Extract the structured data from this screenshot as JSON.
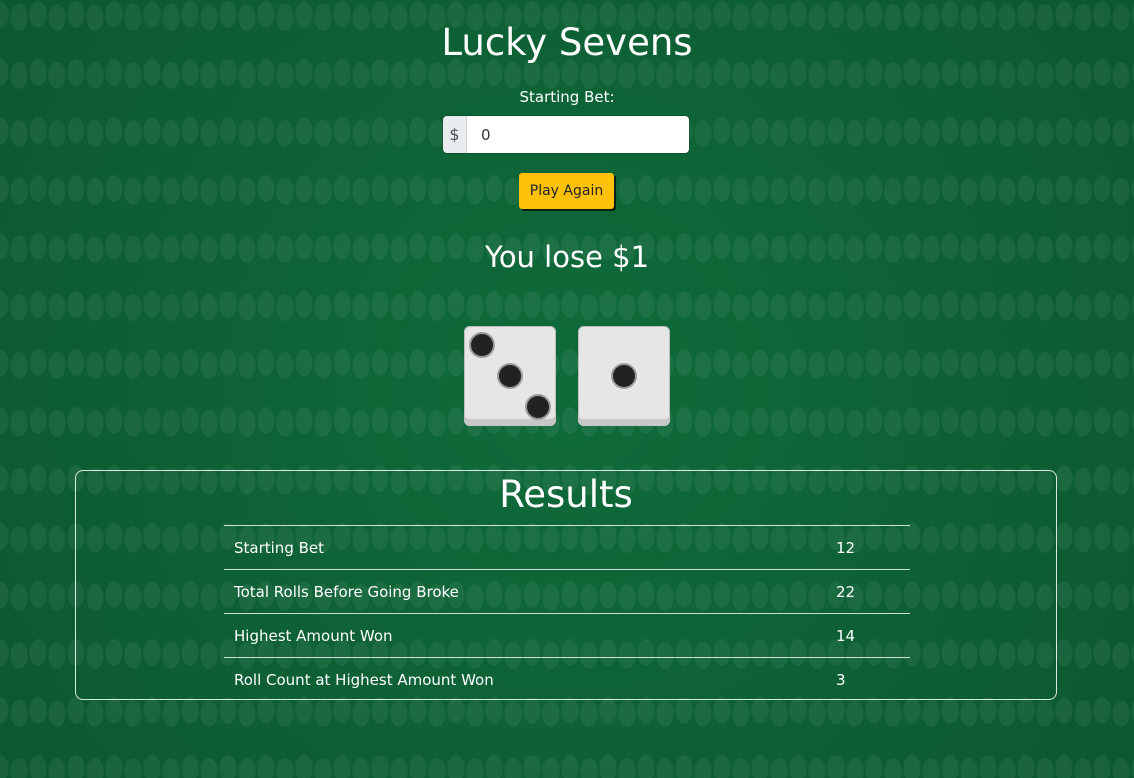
{
  "game": {
    "title": "Lucky Sevens",
    "bet_label": "Starting Bet:",
    "currency_symbol": "$",
    "bet_value": "0",
    "play_button_label": "Play Again",
    "result_message": "You lose $1"
  },
  "dice": [
    {
      "value": 3
    },
    {
      "value": 1
    }
  ],
  "results": {
    "title": "Results",
    "rows": [
      {
        "label": "Starting Bet",
        "value": "12"
      },
      {
        "label": "Total Rolls Before Going Broke",
        "value": "22"
      },
      {
        "label": "Highest Amount Won",
        "value": "14"
      },
      {
        "label": "Roll Count at Highest Amount Won",
        "value": "3"
      }
    ]
  },
  "colors": {
    "felt": "#0f6b3a",
    "button": "#ffc107",
    "text": "#ffffff"
  }
}
